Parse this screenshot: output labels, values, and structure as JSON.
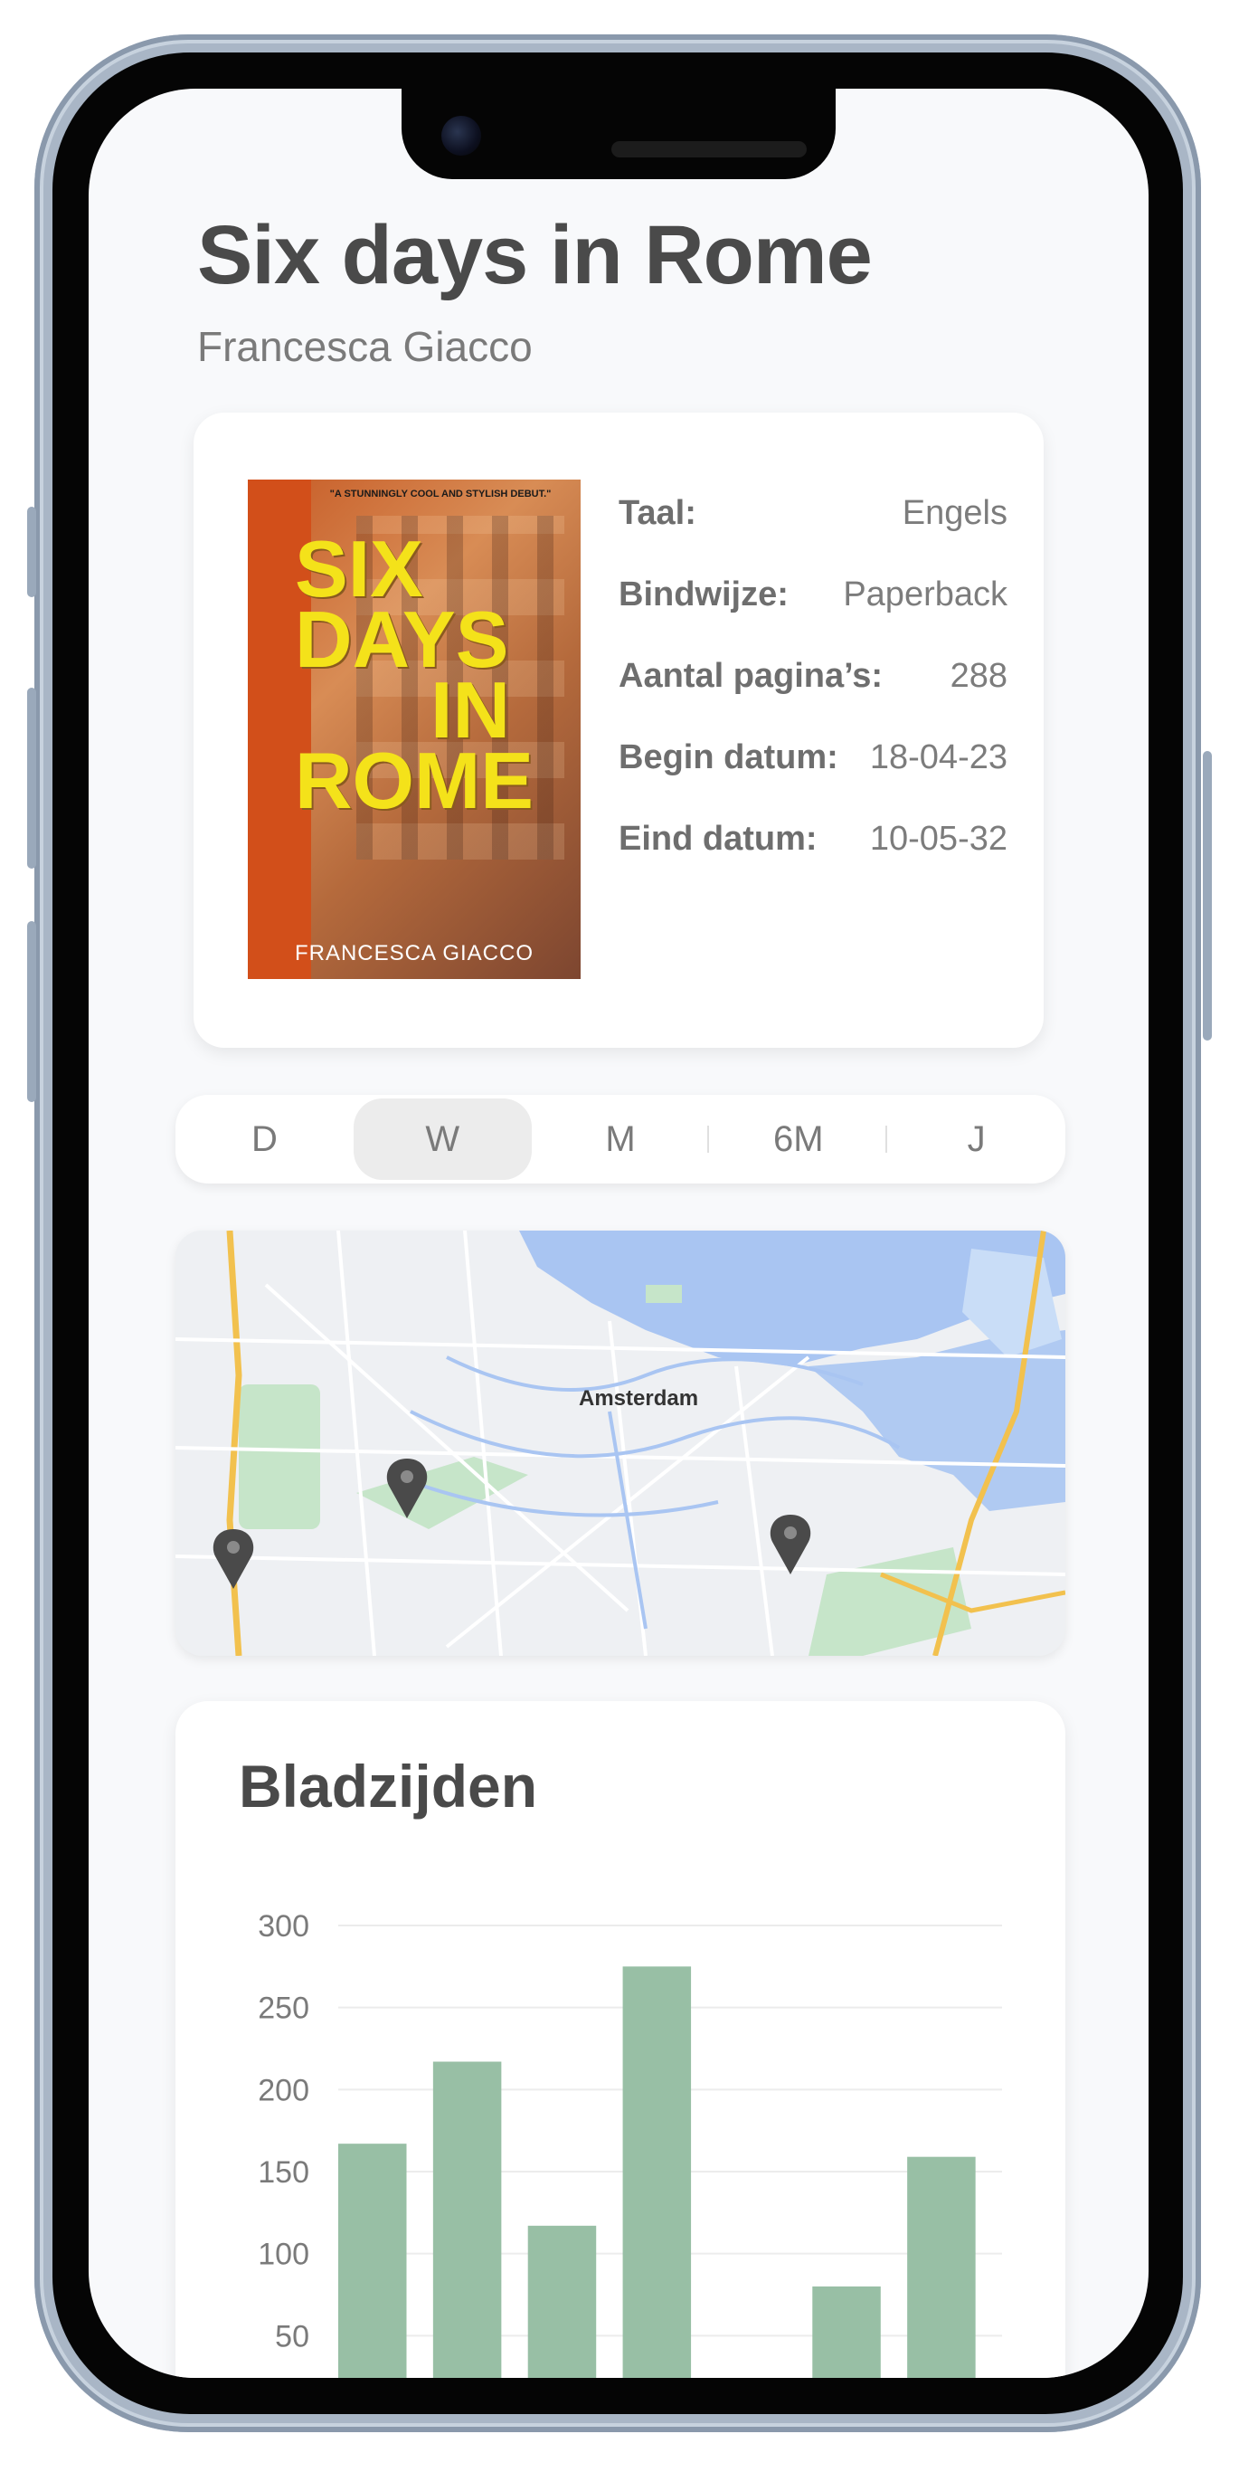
{
  "book": {
    "title": "Six days in Rome",
    "author": "Francesca Giacco",
    "cover": {
      "quote": "\"A STUNNINGLY COOL AND STYLISH DEBUT.\"",
      "title_line1": "SIX",
      "title_line2": "DAYS",
      "title_line3": "IN",
      "title_line4": "ROME",
      "author": "FRANCESCA GIACCO"
    },
    "details": [
      {
        "label": "Taal:",
        "value": "Engels"
      },
      {
        "label": "Bindwijze:",
        "value": "Paperback"
      },
      {
        "label": "Aantal pagina’s:",
        "value": "288"
      },
      {
        "label": "Begin datum:",
        "value": "18-04-23"
      },
      {
        "label": "Eind datum:",
        "value": "10-05-32"
      }
    ]
  },
  "period_selector": {
    "options": [
      "D",
      "W",
      "M",
      "6M",
      "J"
    ],
    "selected": "W"
  },
  "map": {
    "city_label": "Amsterdam",
    "pin_count": 3
  },
  "chart": {
    "heading": "Bladzijden",
    "accent_color": "#98bfa5"
  },
  "chart_data": {
    "type": "bar",
    "title": "Bladzijden",
    "values": [
      167,
      217,
      117,
      275,
      0,
      80,
      159
    ],
    "yticks": [
      50,
      100,
      150,
      200,
      250,
      300
    ],
    "ylim": [
      0,
      300
    ],
    "grid": true,
    "bar_color": "#98bfa5"
  }
}
